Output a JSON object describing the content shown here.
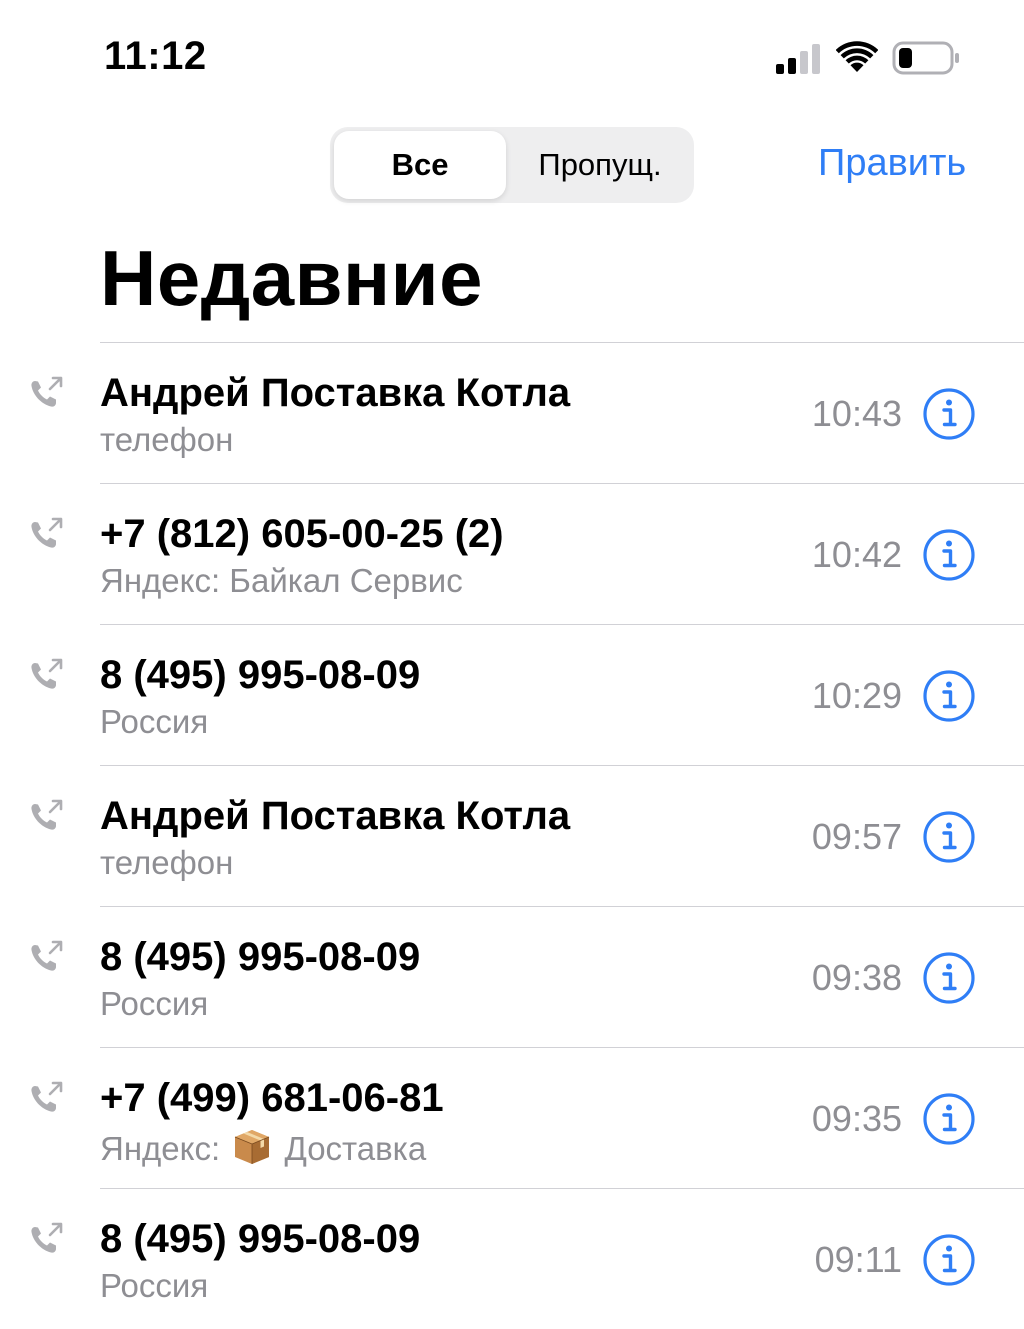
{
  "status_bar": {
    "time": "11:12",
    "signal_icon": "cellular-signal-icon",
    "wifi_icon": "wifi-icon",
    "battery_icon": "battery-low-icon"
  },
  "segmented": {
    "all_label": "Все",
    "missed_label": "Пропущ.",
    "selected": "all"
  },
  "edit_label": "Править",
  "title": "Недавние",
  "calls": [
    {
      "name": "Андрей Поставка Котла",
      "sub": "телефон",
      "time": "10:43"
    },
    {
      "name": "+7 (812) 605-00-25 (2)",
      "sub": "Яндекс: Байкал Сервис",
      "time": "10:42"
    },
    {
      "name": "8 (495) 995-08-09",
      "sub": "Россия",
      "time": "10:29"
    },
    {
      "name": "Андрей Поставка Котла",
      "sub": "телефон",
      "time": "09:57"
    },
    {
      "name": "8 (495) 995-08-09",
      "sub": "Россия",
      "time": "09:38"
    },
    {
      "name": "+7 (499) 681-06-81",
      "sub_prefix": "Яндекс:",
      "sub_suffix": "Доставка",
      "sub_emoji": "package-emoji",
      "time": "09:35"
    },
    {
      "name": "8 (495) 995-08-09",
      "sub": "Россия",
      "time": "09:11"
    }
  ],
  "colors": {
    "accent": "#2f7ef6",
    "secondary_text": "#8e8e93",
    "separator": "#d1d1d6"
  }
}
